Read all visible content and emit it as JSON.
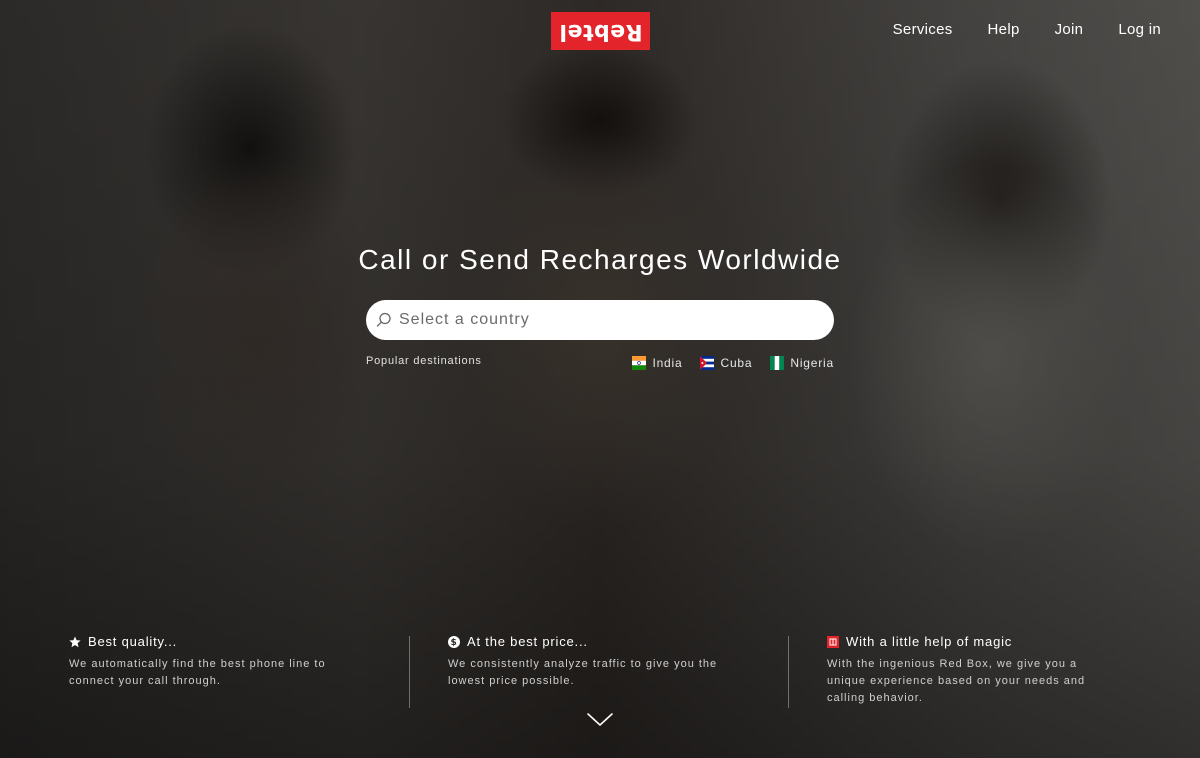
{
  "brand": {
    "logo_text": "Rebtel",
    "accent_color": "#e3242b"
  },
  "nav": {
    "items": [
      {
        "label": "Services"
      },
      {
        "label": "Help"
      },
      {
        "label": "Join"
      },
      {
        "label": "Log in"
      }
    ]
  },
  "hero": {
    "headline": "Call or Send Recharges Worldwide",
    "search": {
      "placeholder": "Select a country",
      "icon": "search-icon"
    },
    "popular_label": "Popular destinations",
    "destinations": [
      {
        "name": "India",
        "flag": "india-flag-icon"
      },
      {
        "name": "Cuba",
        "flag": "cuba-flag-icon"
      },
      {
        "name": "Nigeria",
        "flag": "nigeria-flag-icon"
      }
    ]
  },
  "features": [
    {
      "icon": "star-icon",
      "title": "Best quality...",
      "description": "We automatically find the best phone line to connect your call through."
    },
    {
      "icon": "dollar-icon",
      "title": "At the best price...",
      "description": "We consistently analyze traffic to give you the lowest price possible."
    },
    {
      "icon": "red-box-icon",
      "title": "With a little help of magic",
      "description": "With the ingenious Red Box, we give you a unique experience based on your needs and calling behavior."
    }
  ],
  "scroll_indicator": {
    "icon": "chevron-down-icon"
  }
}
